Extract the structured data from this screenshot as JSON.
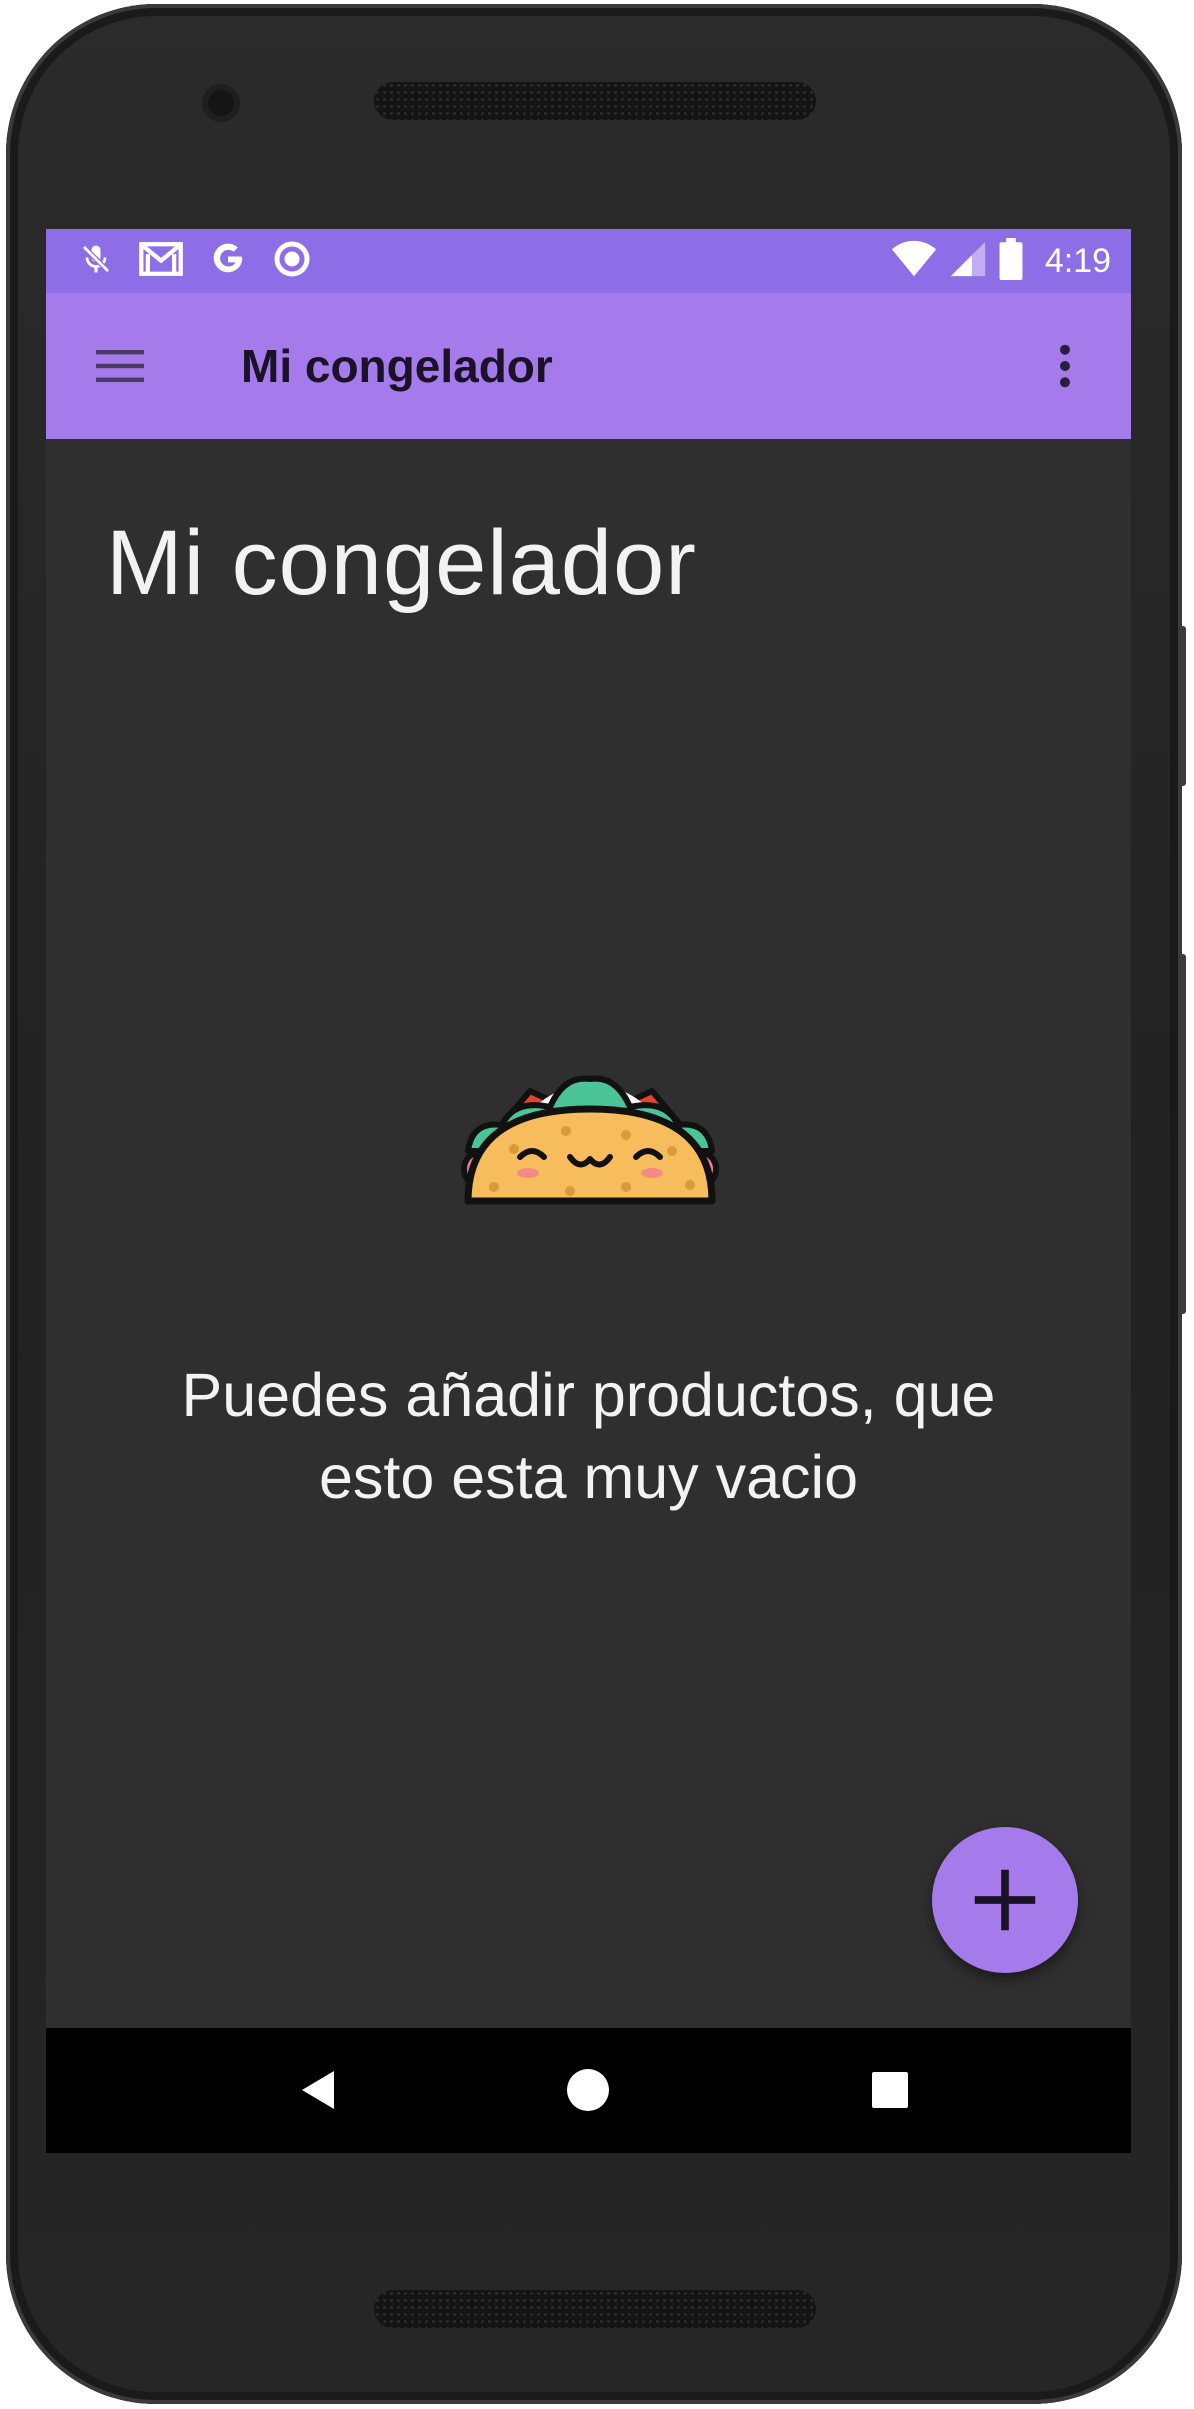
{
  "status_bar": {
    "time": "4:19",
    "icons": [
      "mic-off-icon",
      "gmail-icon",
      "google-icon",
      "record-icon",
      "wifi-icon",
      "signal-icon",
      "battery-icon"
    ]
  },
  "app_bar": {
    "title": "Mi congelador",
    "icons": [
      "menu-icon",
      "more-vert-icon"
    ]
  },
  "main": {
    "heading": "Mi congelador",
    "empty_state": {
      "illustration": "taco-icon",
      "message_line1": "Puedes añadir productos, que",
      "message_line2": "esto esta muy vacio"
    }
  },
  "fab": {
    "icon": "add-icon"
  },
  "nav_bar": {
    "icons": [
      "back-icon",
      "home-icon",
      "recents-icon"
    ]
  },
  "colors": {
    "status_bar": "#8e6ee6",
    "app_bar": "#a57aea",
    "background": "#2f2f2f",
    "fab": "#a57aea",
    "nav_bar": "#000000"
  }
}
